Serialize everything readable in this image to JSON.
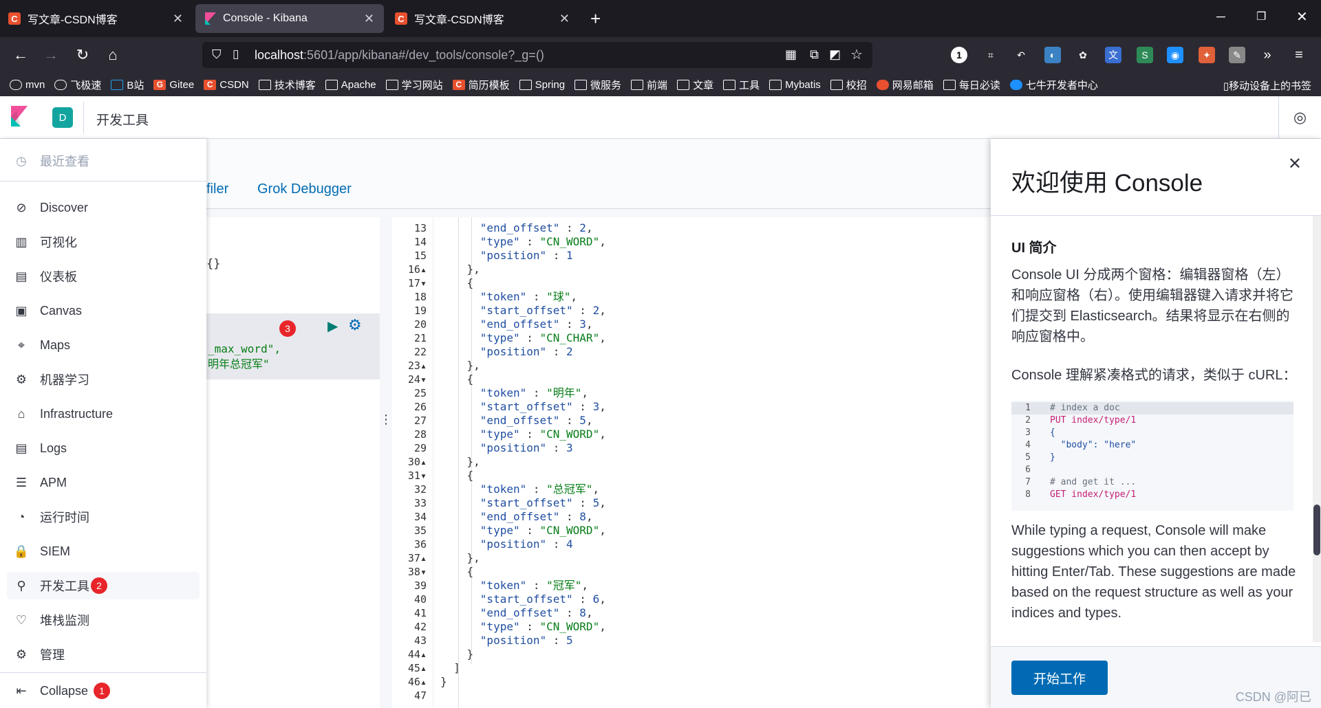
{
  "browser": {
    "tabs": [
      {
        "title": "写文章-CSDN博客",
        "icon": "C"
      },
      {
        "title": "Console - Kibana",
        "icon": "K"
      },
      {
        "title": "写文章-CSDN博客",
        "icon": "C"
      }
    ],
    "new_tab": "+",
    "url_host": "localhost",
    "url_path": ":5601/app/kibana#/dev_tools/console?_g=()",
    "bookmarks": [
      "mvn",
      "飞极速",
      "B站",
      "Gitee",
      "CSDN",
      "技术博客",
      "Apache",
      "学习网站",
      "简历模板",
      "Spring",
      "微服务",
      "前端",
      "文章",
      "工具",
      "Mybatis",
      "校招",
      "网易邮箱",
      "每日必读",
      "七牛开发者中心"
    ],
    "mobile_bookmarks": "移动设备上的书签"
  },
  "header": {
    "space_initial": "D",
    "breadcrumb": "开发工具"
  },
  "sidebar": {
    "recent": "最近查看",
    "items": [
      {
        "label": "Discover",
        "icon": "compass-icon"
      },
      {
        "label": "可视化",
        "icon": "visualize-icon"
      },
      {
        "label": "仪表板",
        "icon": "dashboard-icon"
      },
      {
        "label": "Canvas",
        "icon": "canvas-icon"
      },
      {
        "label": "Maps",
        "icon": "map-pin-icon"
      },
      {
        "label": "机器学习",
        "icon": "ml-icon"
      },
      {
        "label": "Infrastructure",
        "icon": "infra-icon"
      },
      {
        "label": "Logs",
        "icon": "logs-icon"
      },
      {
        "label": "APM",
        "icon": "apm-icon"
      },
      {
        "label": "运行时间",
        "icon": "uptime-icon"
      },
      {
        "label": "SIEM",
        "icon": "lock-icon"
      },
      {
        "label": "开发工具",
        "icon": "wrench-icon"
      },
      {
        "label": "堆栈监测",
        "icon": "heartbeat-icon"
      },
      {
        "label": "管理",
        "icon": "gear-icon"
      }
    ],
    "devtools_badge": "2",
    "collapse": "Collapse",
    "collapse_badge": "1"
  },
  "devtools": {
    "tabs": [
      "filer",
      "Grok Debugger"
    ],
    "left_braces": "{}",
    "left_line1": "_max_word\",",
    "left_line2": "明年总冠军\"",
    "badge": "3",
    "resizer": "⋮"
  },
  "response": {
    "lines": [
      {
        "n": "13",
        "f": "",
        "ind": 6,
        "k": "\"end_offset\"",
        "v": "2",
        "vt": "n",
        "c": true
      },
      {
        "n": "14",
        "f": "",
        "ind": 6,
        "k": "\"type\"",
        "v": "\"CN_WORD\"",
        "vt": "s",
        "c": true
      },
      {
        "n": "15",
        "f": "",
        "ind": 6,
        "k": "\"position\"",
        "v": "1",
        "vt": "n",
        "c": false
      },
      {
        "n": "16",
        "f": "▴",
        "ind": 4,
        "t": "},"
      },
      {
        "n": "17",
        "f": "▾",
        "ind": 4,
        "t": "{"
      },
      {
        "n": "18",
        "f": "",
        "ind": 6,
        "k": "\"token\"",
        "v": "\"球\"",
        "vt": "s",
        "c": true
      },
      {
        "n": "19",
        "f": "",
        "ind": 6,
        "k": "\"start_offset\"",
        "v": "2",
        "vt": "n",
        "c": true
      },
      {
        "n": "20",
        "f": "",
        "ind": 6,
        "k": "\"end_offset\"",
        "v": "3",
        "vt": "n",
        "c": true
      },
      {
        "n": "21",
        "f": "",
        "ind": 6,
        "k": "\"type\"",
        "v": "\"CN_CHAR\"",
        "vt": "s",
        "c": true
      },
      {
        "n": "22",
        "f": "",
        "ind": 6,
        "k": "\"position\"",
        "v": "2",
        "vt": "n",
        "c": false
      },
      {
        "n": "23",
        "f": "▴",
        "ind": 4,
        "t": "},"
      },
      {
        "n": "24",
        "f": "▾",
        "ind": 4,
        "t": "{"
      },
      {
        "n": "25",
        "f": "",
        "ind": 6,
        "k": "\"token\"",
        "v": "\"明年\"",
        "vt": "s",
        "c": true
      },
      {
        "n": "26",
        "f": "",
        "ind": 6,
        "k": "\"start_offset\"",
        "v": "3",
        "vt": "n",
        "c": true
      },
      {
        "n": "27",
        "f": "",
        "ind": 6,
        "k": "\"end_offset\"",
        "v": "5",
        "vt": "n",
        "c": true
      },
      {
        "n": "28",
        "f": "",
        "ind": 6,
        "k": "\"type\"",
        "v": "\"CN_WORD\"",
        "vt": "s",
        "c": true
      },
      {
        "n": "29",
        "f": "",
        "ind": 6,
        "k": "\"position\"",
        "v": "3",
        "vt": "n",
        "c": false
      },
      {
        "n": "30",
        "f": "▴",
        "ind": 4,
        "t": "},"
      },
      {
        "n": "31",
        "f": "▾",
        "ind": 4,
        "t": "{"
      },
      {
        "n": "32",
        "f": "",
        "ind": 6,
        "k": "\"token\"",
        "v": "\"总冠军\"",
        "vt": "s",
        "c": true
      },
      {
        "n": "33",
        "f": "",
        "ind": 6,
        "k": "\"start_offset\"",
        "v": "5",
        "vt": "n",
        "c": true
      },
      {
        "n": "34",
        "f": "",
        "ind": 6,
        "k": "\"end_offset\"",
        "v": "8",
        "vt": "n",
        "c": true
      },
      {
        "n": "35",
        "f": "",
        "ind": 6,
        "k": "\"type\"",
        "v": "\"CN_WORD\"",
        "vt": "s",
        "c": true
      },
      {
        "n": "36",
        "f": "",
        "ind": 6,
        "k": "\"position\"",
        "v": "4",
        "vt": "n",
        "c": false
      },
      {
        "n": "37",
        "f": "▴",
        "ind": 4,
        "t": "},"
      },
      {
        "n": "38",
        "f": "▾",
        "ind": 4,
        "t": "{"
      },
      {
        "n": "39",
        "f": "",
        "ind": 6,
        "k": "\"token\"",
        "v": "\"冠军\"",
        "vt": "s",
        "c": true
      },
      {
        "n": "40",
        "f": "",
        "ind": 6,
        "k": "\"start_offset\"",
        "v": "6",
        "vt": "n",
        "c": true
      },
      {
        "n": "41",
        "f": "",
        "ind": 6,
        "k": "\"end_offset\"",
        "v": "8",
        "vt": "n",
        "c": true
      },
      {
        "n": "42",
        "f": "",
        "ind": 6,
        "k": "\"type\"",
        "v": "\"CN_WORD\"",
        "vt": "s",
        "c": true
      },
      {
        "n": "43",
        "f": "",
        "ind": 6,
        "k": "\"position\"",
        "v": "5",
        "vt": "n",
        "c": false
      },
      {
        "n": "44",
        "f": "▴",
        "ind": 4,
        "t": "}"
      },
      {
        "n": "45",
        "f": "▴",
        "ind": 2,
        "t": "]"
      },
      {
        "n": "46",
        "f": "▴",
        "ind": 0,
        "t": "}"
      },
      {
        "n": "47",
        "f": "",
        "ind": 0,
        "t": ""
      }
    ]
  },
  "flyout": {
    "title": "欢迎使用 Console",
    "heading": "UI 简介",
    "p1": "Console UI 分成两个窗格：编辑器窗格（左）和响应窗格（右）。使用编辑器键入请求并将它们提交到 Elasticsearch。结果将显示在右侧的响应窗格中。",
    "p2": "Console 理解紧凑格式的请求，类似于 cURL：",
    "code": [
      {
        "n": "1",
        "t": "# index a doc",
        "c": "comment"
      },
      {
        "n": "2",
        "t": "PUT index/type/1",
        "c": "method"
      },
      {
        "n": "3",
        "t": "{",
        "c": "plain"
      },
      {
        "n": "4",
        "t": "  \"body\": \"here\"",
        "c": "plain"
      },
      {
        "n": "5",
        "t": "}",
        "c": "plain"
      },
      {
        "n": "6",
        "t": "",
        "c": "plain"
      },
      {
        "n": "7",
        "t": "# and get it ...",
        "c": "comment"
      },
      {
        "n": "8",
        "t": "GET index/type/1",
        "c": "method"
      }
    ],
    "p3": "While typing a request, Console will make suggestions which you can then accept by hitting Enter/Tab. These suggestions are made based on the request structure as well as your indices and types.",
    "start_button": "开始工作"
  },
  "watermark": "CSDN @阿已",
  "colors": {
    "accent": "#006bb4",
    "badge": "#e7252a",
    "string": "#067d17",
    "key": "#1f4ea1"
  }
}
